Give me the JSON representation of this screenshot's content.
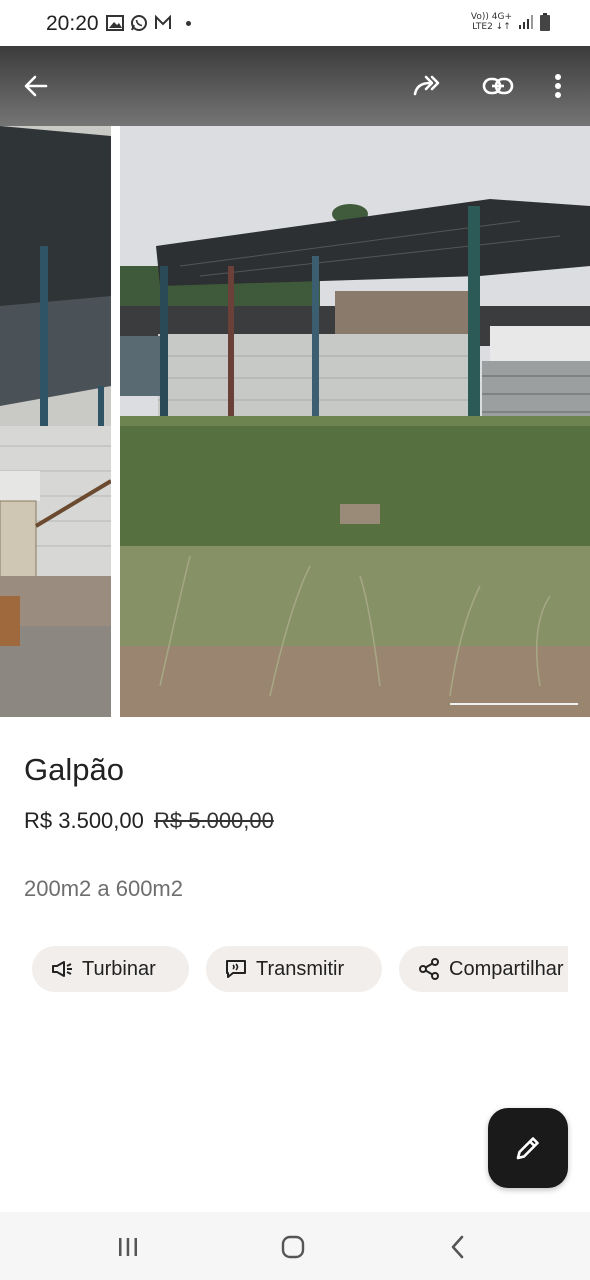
{
  "status_bar": {
    "time": "20:20",
    "icons": [
      "gallery-icon",
      "whatsapp-icon",
      "gmail-icon"
    ],
    "network_top": "Vo)) 4G+",
    "network_bottom": "LTE2 ↓↑"
  },
  "app_bar": {
    "icons": [
      "back-arrow-icon",
      "forward-share-icon",
      "link-icon",
      "more-vert-icon"
    ]
  },
  "listing": {
    "title": "Galpão",
    "price": "R$ 3.500,00",
    "old_price": "R$ 5.000,00",
    "size": "200m2 a 600m2"
  },
  "actions": [
    {
      "label": "Turbinar",
      "icon": "megaphone-icon"
    },
    {
      "label": "Transmitir",
      "icon": "broadcast-message-icon"
    },
    {
      "label": "Compartilhar",
      "icon": "share-icon"
    }
  ],
  "fab": {
    "icon": "pencil-icon"
  },
  "nav_bar": {
    "icons": [
      "recents-icon",
      "home-icon",
      "back-icon"
    ]
  },
  "colors": {
    "app_bar_top": "#3b3b3b",
    "chip_bg": "#f2eeec",
    "fab_bg": "#1a1a1a"
  }
}
